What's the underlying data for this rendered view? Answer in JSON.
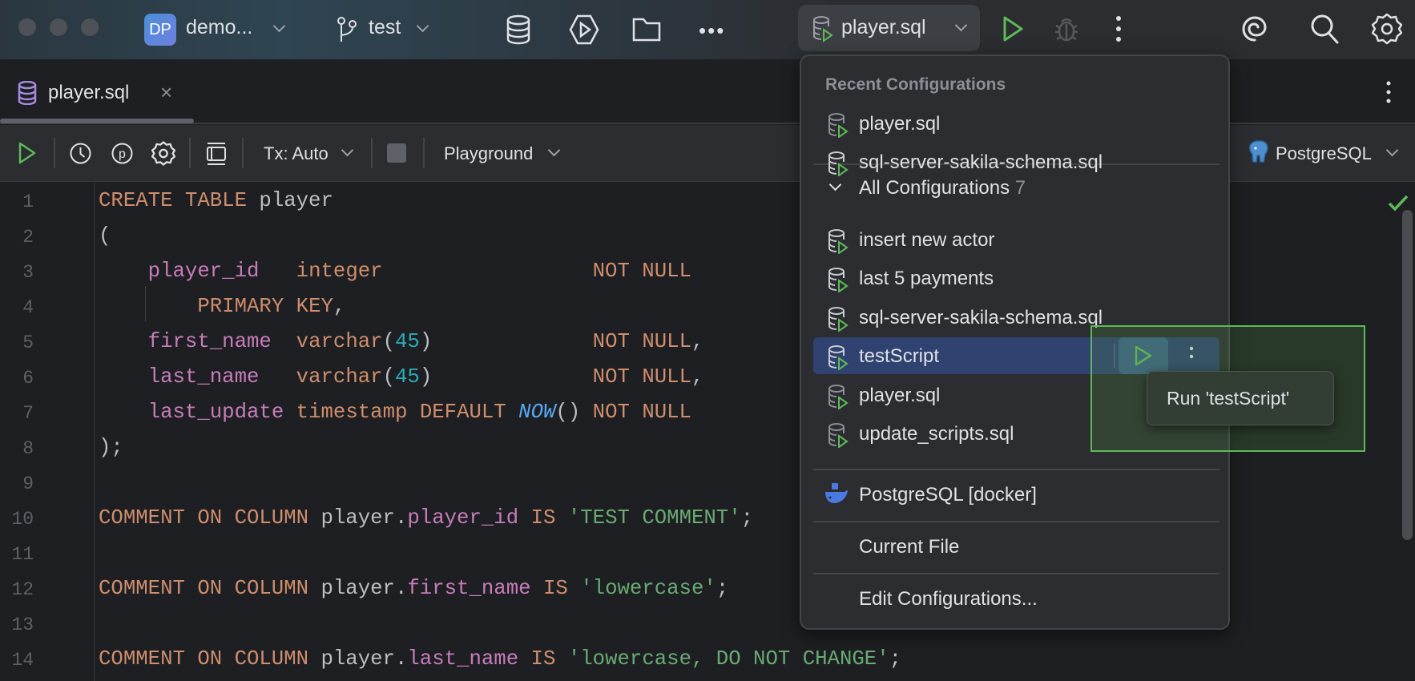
{
  "titlebar": {
    "project_badge": "DP",
    "project_name": "demo...",
    "branch": "test",
    "run_config": "player.sql"
  },
  "tab": {
    "file_name": "player.sql",
    "close": "×"
  },
  "toolbar": {
    "tx_mode": "Tx: Auto",
    "schema": "Playground",
    "datasource": "PostgreSQL"
  },
  "editor": {
    "line_numbers": [
      "1",
      "2",
      "3",
      "4",
      "5",
      "6",
      "7",
      "8",
      "9",
      "10",
      "11",
      "12",
      "13",
      "14"
    ],
    "lines": [
      [
        [
          "CREATE TABLE",
          "kw"
        ],
        [
          " player",
          "pl"
        ]
      ],
      [
        [
          "(",
          "pl"
        ]
      ],
      [
        [
          "    ",
          "pl"
        ],
        [
          "player_id",
          "col"
        ],
        [
          "   ",
          "pl"
        ],
        [
          "integer",
          "kw"
        ],
        [
          "                 ",
          "pl"
        ],
        [
          "NOT NULL",
          "kw"
        ]
      ],
      [
        [
          "        ",
          "pl"
        ],
        [
          "PRIMARY KEY",
          "kw"
        ],
        [
          ",",
          "pl"
        ]
      ],
      [
        [
          "    ",
          "pl"
        ],
        [
          "first_name",
          "col"
        ],
        [
          "  ",
          "pl"
        ],
        [
          "varchar",
          "kw"
        ],
        [
          "(",
          "pl"
        ],
        [
          "45",
          "num"
        ],
        [
          ")",
          "pl"
        ],
        [
          "             ",
          "pl"
        ],
        [
          "NOT NULL",
          "kw"
        ],
        [
          ",",
          "pl"
        ]
      ],
      [
        [
          "    ",
          "pl"
        ],
        [
          "last_name",
          "col"
        ],
        [
          "   ",
          "pl"
        ],
        [
          "varchar",
          "kw"
        ],
        [
          "(",
          "pl"
        ],
        [
          "45",
          "num"
        ],
        [
          ")",
          "pl"
        ],
        [
          "             ",
          "pl"
        ],
        [
          "NOT NULL",
          "kw"
        ],
        [
          ",",
          "pl"
        ]
      ],
      [
        [
          "    ",
          "pl"
        ],
        [
          "last_update",
          "col"
        ],
        [
          " ",
          "pl"
        ],
        [
          "timestamp DEFAULT",
          "kw"
        ],
        [
          " ",
          "pl"
        ],
        [
          "NOW",
          "fn"
        ],
        [
          "() ",
          "pl"
        ],
        [
          "NOT NULL",
          "kw"
        ]
      ],
      [
        [
          ");",
          "pl"
        ]
      ],
      [],
      [
        [
          "COMMENT ON COLUMN",
          "kw"
        ],
        [
          " player.",
          "pl"
        ],
        [
          "player_id",
          "col"
        ],
        [
          " ",
          "pl"
        ],
        [
          "IS",
          "kw"
        ],
        [
          " ",
          "pl"
        ],
        [
          "'TEST COMMENT'",
          "str"
        ],
        [
          ";",
          "pl"
        ]
      ],
      [],
      [
        [
          "COMMENT ON COLUMN",
          "kw"
        ],
        [
          " player.",
          "pl"
        ],
        [
          "first_name",
          "col"
        ],
        [
          " ",
          "pl"
        ],
        [
          "IS",
          "kw"
        ],
        [
          " ",
          "pl"
        ],
        [
          "'lowercase'",
          "str"
        ],
        [
          ";",
          "pl"
        ]
      ],
      [],
      [
        [
          "COMMENT ON COLUMN",
          "kw"
        ],
        [
          " player.",
          "pl"
        ],
        [
          "last_name",
          "col"
        ],
        [
          " ",
          "pl"
        ],
        [
          "IS",
          "kw"
        ],
        [
          " ",
          "pl"
        ],
        [
          "'lowercase, DO NOT CHANGE'",
          "str"
        ],
        [
          ";",
          "pl"
        ]
      ]
    ]
  },
  "popup": {
    "recent_header": "Recent Configurations",
    "recent": [
      "player.sql",
      "sql-server-sakila-schema.sql"
    ],
    "all_header": "All Configurations",
    "all_count": "7",
    "all": [
      "insert new actor",
      "last 5 payments",
      "sql-server-sakila-schema.sql",
      "testScript",
      "player.sql",
      "update_scripts.sql"
    ],
    "selected": "testScript",
    "docker": "PostgreSQL [docker]",
    "current_file": "Current File",
    "edit": "Edit Configurations..."
  },
  "tooltip": {
    "text": "Run 'testScript'"
  },
  "colors": {
    "run_green": "#5fb85a",
    "selection": "#2f4270",
    "keyword": "#cf8e6d",
    "string": "#6aab73"
  }
}
